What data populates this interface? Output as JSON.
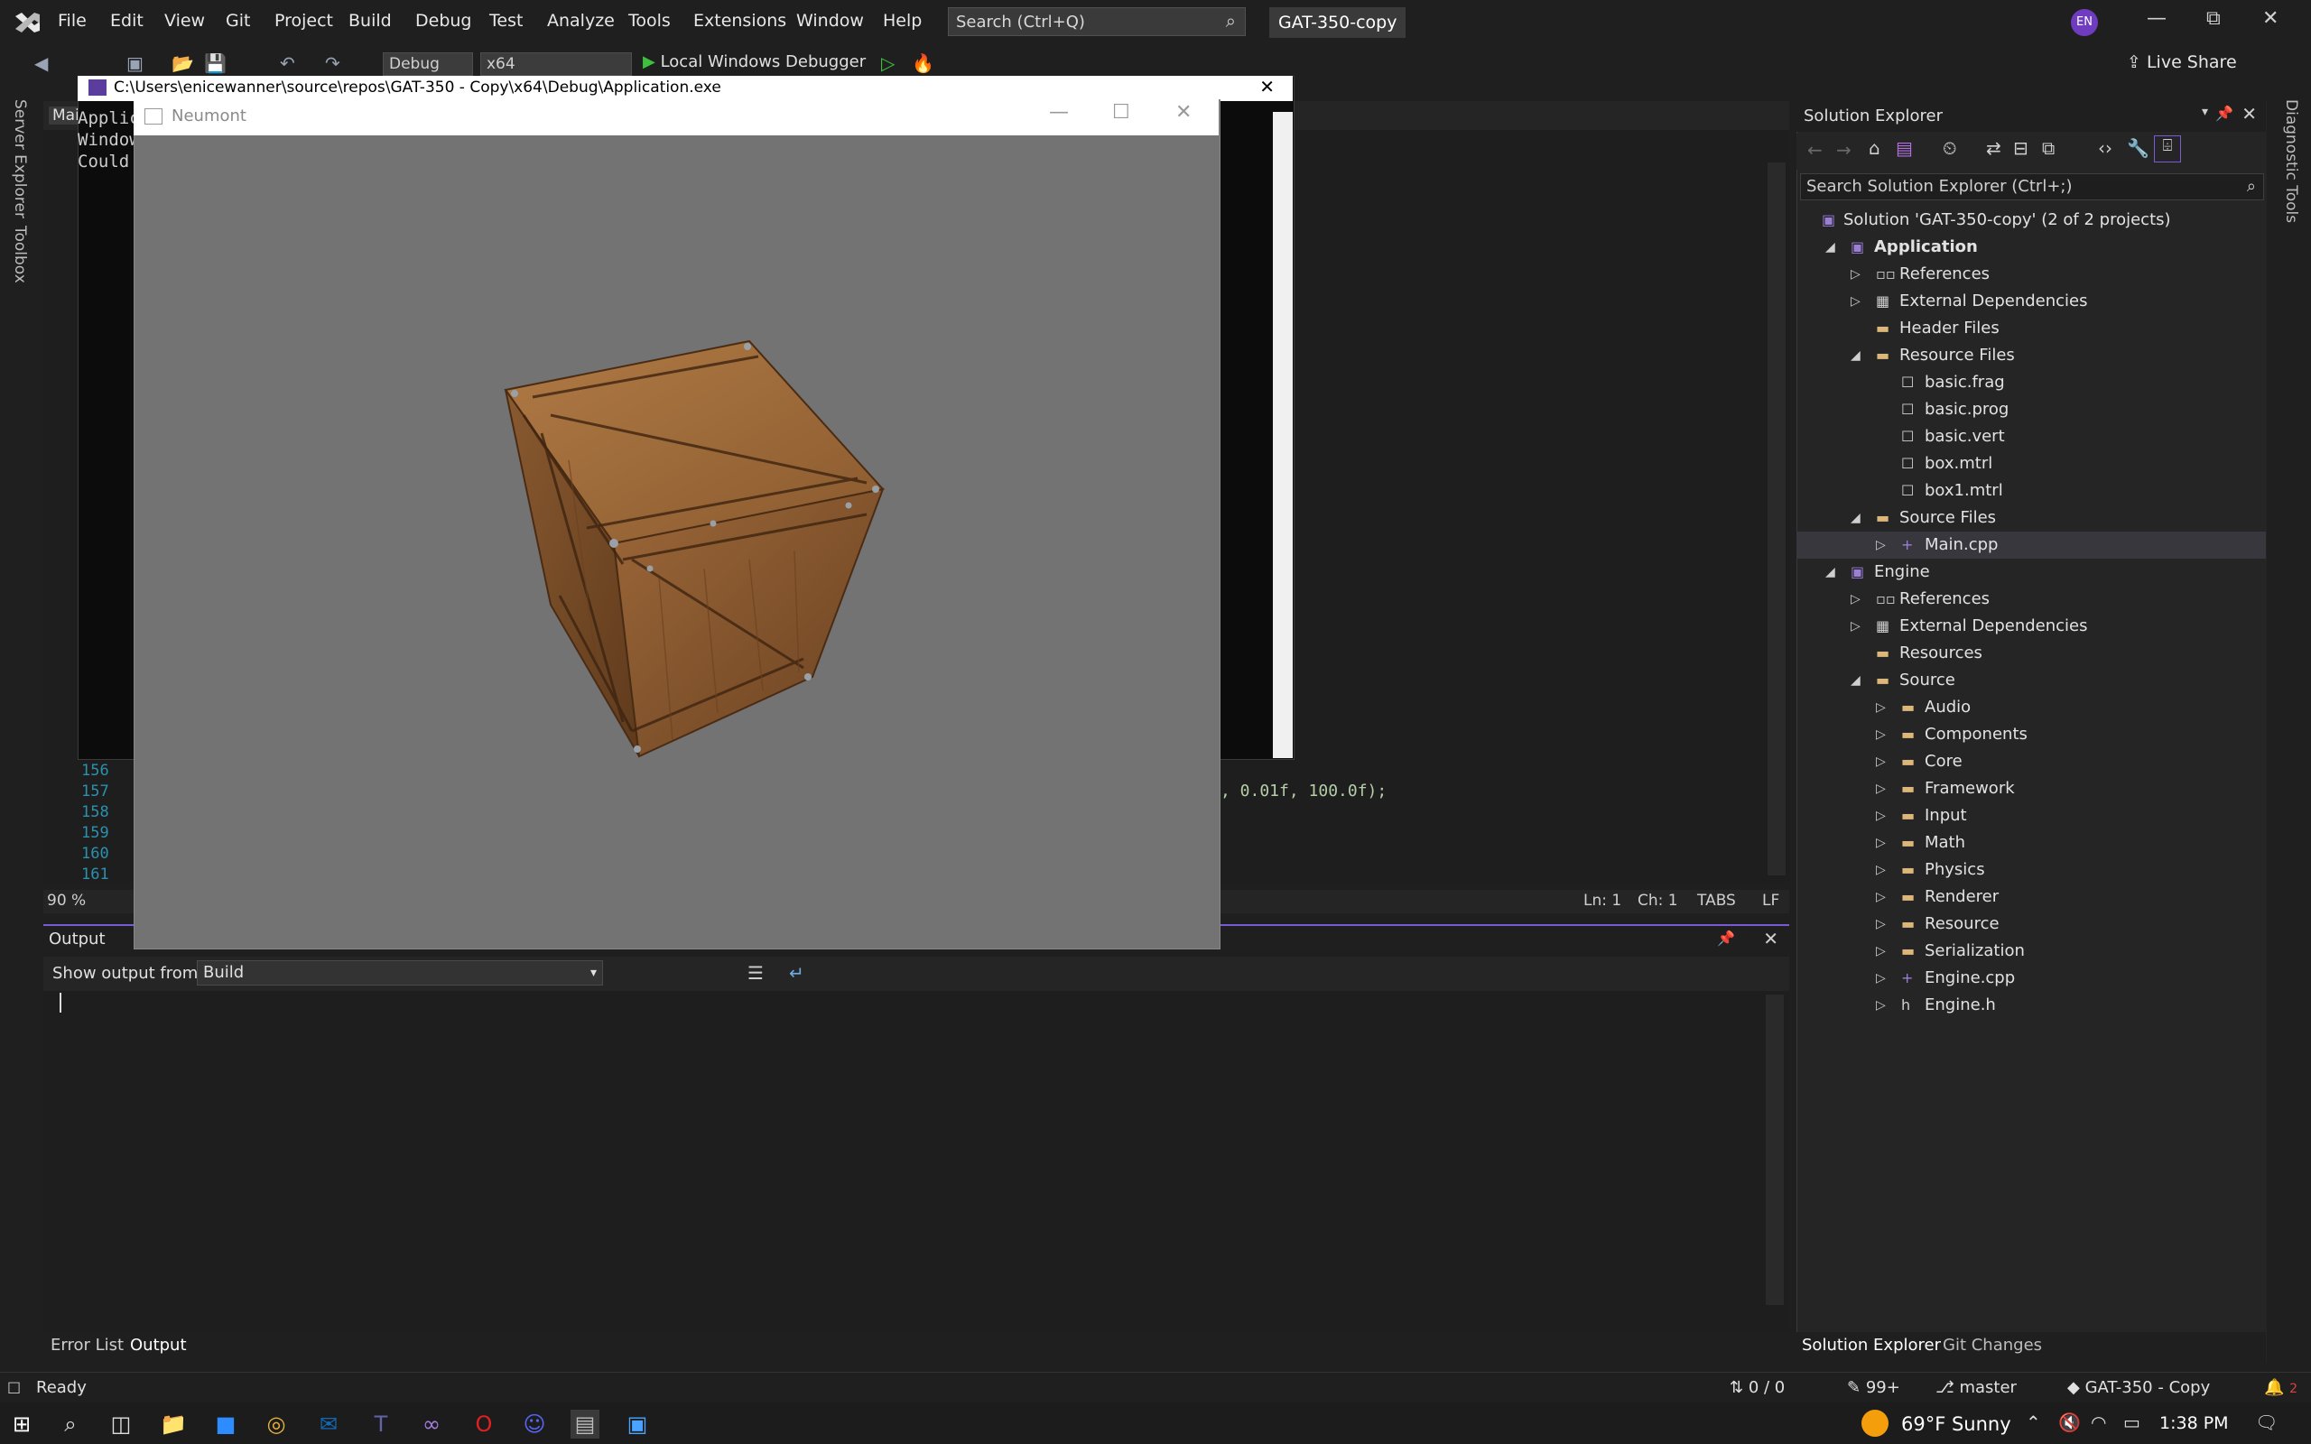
{
  "menu": {
    "items": [
      "File",
      "Edit",
      "View",
      "Git",
      "Project",
      "Build",
      "Debug",
      "Test",
      "Analyze",
      "Tools",
      "Extensions",
      "Window",
      "Help"
    ],
    "search_placeholder": "Search (Ctrl+Q)",
    "project_name": "GAT-350-copy",
    "user_initials": "EN"
  },
  "toolbar": {
    "config": "Debug",
    "platform": "x64",
    "debugger": "Local Windows Debugger",
    "live_share": "Live Share"
  },
  "left_tabs": {
    "server_explorer": "Server Explorer",
    "toolbox": "Toolbox"
  },
  "right_tabs": {
    "diagnostic_tools": "Diagnostic Tools"
  },
  "editor": {
    "tab_label": "Mai",
    "line_numbers": [
      "156",
      "157",
      "158",
      "159",
      "160",
      "161"
    ],
    "code_fragment": ", 0.01f, 100.0f);",
    "zoom": "90 %",
    "status": {
      "ln": "Ln: 1",
      "ch": "Ch: 1",
      "tabs": "TABS",
      "eol": "LF"
    }
  },
  "console_window": {
    "title": "C:\\Users\\enicewanner\\source\\repos\\GAT-350 - Copy\\x64\\Debug\\Application.exe",
    "lines": [
      "Applic",
      "Window",
      "Could"
    ]
  },
  "neumont_window": {
    "title": "Neumont"
  },
  "output_panel": {
    "title": "Output",
    "show_from_label": "Show output from:",
    "source": "Build"
  },
  "bottom_tabs": {
    "error_list": "Error List",
    "output": "Output"
  },
  "solution_explorer": {
    "title": "Solution Explorer",
    "search_placeholder": "Search Solution Explorer (Ctrl+;)",
    "solution": "Solution 'GAT-350-copy' (2 of 2 projects)",
    "tree": [
      {
        "label": "Application",
        "indent": 1,
        "bold": true,
        "arrow": "open"
      },
      {
        "label": "References",
        "indent": 2,
        "arrow": "closed"
      },
      {
        "label": "External Dependencies",
        "indent": 2,
        "arrow": "closed"
      },
      {
        "label": "Header Files",
        "indent": 2,
        "arrow": ""
      },
      {
        "label": "Resource Files",
        "indent": 2,
        "arrow": "open"
      },
      {
        "label": "basic.frag",
        "indent": 3,
        "arrow": ""
      },
      {
        "label": "basic.prog",
        "indent": 3,
        "arrow": ""
      },
      {
        "label": "basic.vert",
        "indent": 3,
        "arrow": ""
      },
      {
        "label": "box.mtrl",
        "indent": 3,
        "arrow": ""
      },
      {
        "label": "box1.mtrl",
        "indent": 3,
        "arrow": ""
      },
      {
        "label": "Source Files",
        "indent": 2,
        "arrow": "open"
      },
      {
        "label": "Main.cpp",
        "indent": 3,
        "arrow": "closed",
        "selected": true
      },
      {
        "label": "Engine",
        "indent": 1,
        "arrow": "open"
      },
      {
        "label": "References",
        "indent": 2,
        "arrow": "closed"
      },
      {
        "label": "External Dependencies",
        "indent": 2,
        "arrow": "closed"
      },
      {
        "label": "Resources",
        "indent": 2,
        "arrow": ""
      },
      {
        "label": "Source",
        "indent": 2,
        "arrow": "open"
      },
      {
        "label": "Audio",
        "indent": 3,
        "arrow": "closed"
      },
      {
        "label": "Components",
        "indent": 3,
        "arrow": "closed"
      },
      {
        "label": "Core",
        "indent": 3,
        "arrow": "closed"
      },
      {
        "label": "Framework",
        "indent": 3,
        "arrow": "closed"
      },
      {
        "label": "Input",
        "indent": 3,
        "arrow": "closed"
      },
      {
        "label": "Math",
        "indent": 3,
        "arrow": "closed"
      },
      {
        "label": "Physics",
        "indent": 3,
        "arrow": "closed"
      },
      {
        "label": "Renderer",
        "indent": 3,
        "arrow": "closed"
      },
      {
        "label": "Resource",
        "indent": 3,
        "arrow": "closed"
      },
      {
        "label": "Serialization",
        "indent": 3,
        "arrow": "closed"
      },
      {
        "label": "Engine.cpp",
        "indent": 3,
        "arrow": "closed"
      },
      {
        "label": "Engine.h",
        "indent": 3,
        "arrow": "closed"
      }
    ],
    "bottom_tabs": [
      "Solution Explorer",
      "Git Changes"
    ]
  },
  "statusbar": {
    "ready": "Ready",
    "arrows": "0 / 0",
    "edits": "99+",
    "branch": "master",
    "repo": "GAT-350 - Copy",
    "notifications": "2"
  },
  "taskbar": {
    "weather": "69°F  Sunny",
    "time": "1:38 PM"
  },
  "colors": {
    "accent": "#7a5bd6",
    "avatar": "#6f3bbf",
    "bg": "#1f1f1f"
  }
}
